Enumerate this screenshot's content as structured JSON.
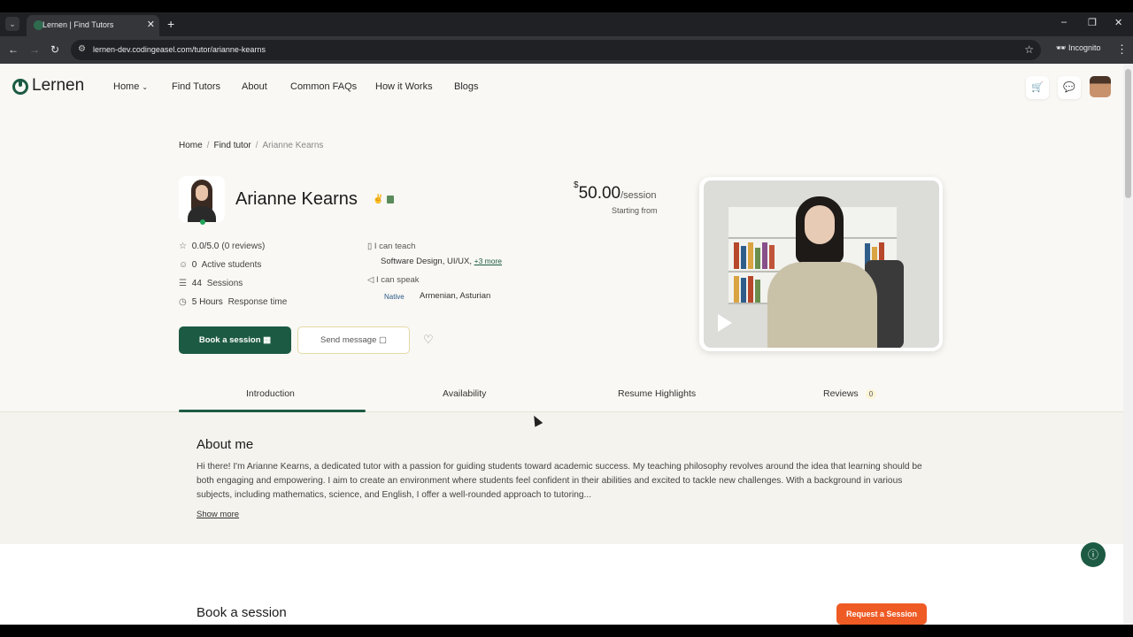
{
  "browser": {
    "tab_title": "Lernen | Find Tutors",
    "url": "lernen-dev.codingeasel.com/tutor/arianne-kearns",
    "mode_label": "Incognito"
  },
  "site": {
    "logo_text": "Lernen",
    "nav": [
      "Home",
      "Find Tutors",
      "About",
      "Common FAQs",
      "How it Works",
      "Blogs"
    ]
  },
  "breadcrumb": {
    "home": "Home",
    "find_tutor": "Find tutor",
    "current": "Arianne Kearns"
  },
  "profile": {
    "name": "Arianne Kearns",
    "rating": "0.0/5.0",
    "reviews": "(0 reviews)",
    "active_students_num": "0",
    "active_students_label": "Active students",
    "sessions_num": "44",
    "sessions_label": "Sessions",
    "response_num": "5 Hours",
    "response_label": "Response time",
    "teach_label": "I can teach",
    "teach_value": "Software Design, UI/UX,",
    "teach_more": "+3 more",
    "speak_label": "I can speak",
    "native_label": "Native",
    "languages": "Armenian,  Asturian",
    "price_currency": "$",
    "price_amount": "50.00",
    "price_unit": "/session",
    "price_sub": "Starting from",
    "book_button": "Book a session",
    "message_button": "Send message"
  },
  "tabs": [
    {
      "label": "Introduction",
      "active": true
    },
    {
      "label": "Availability"
    },
    {
      "label": "Resume Highlights"
    },
    {
      "label": "Reviews",
      "count": "0"
    }
  ],
  "about": {
    "heading": "About me",
    "text": "Hi there! I'm Arianne Kearns, a dedicated tutor with a passion for guiding students toward academic success. My teaching philosophy revolves around the idea that learning should be both engaging and empowering. I aim to create an environment where students feel confident in their abilities and excited to tackle new challenges. With a background in various subjects, including mathematics, science, and English, I offer a well-rounded approach to tutoring...",
    "show_more": "Show more"
  },
  "booking": {
    "heading": "Book a session",
    "request_button": "Request a Session"
  },
  "colors": {
    "brand": "#1d5a44",
    "accent_orange": "#ef5b25",
    "page_bg": "#f9f8f4"
  }
}
